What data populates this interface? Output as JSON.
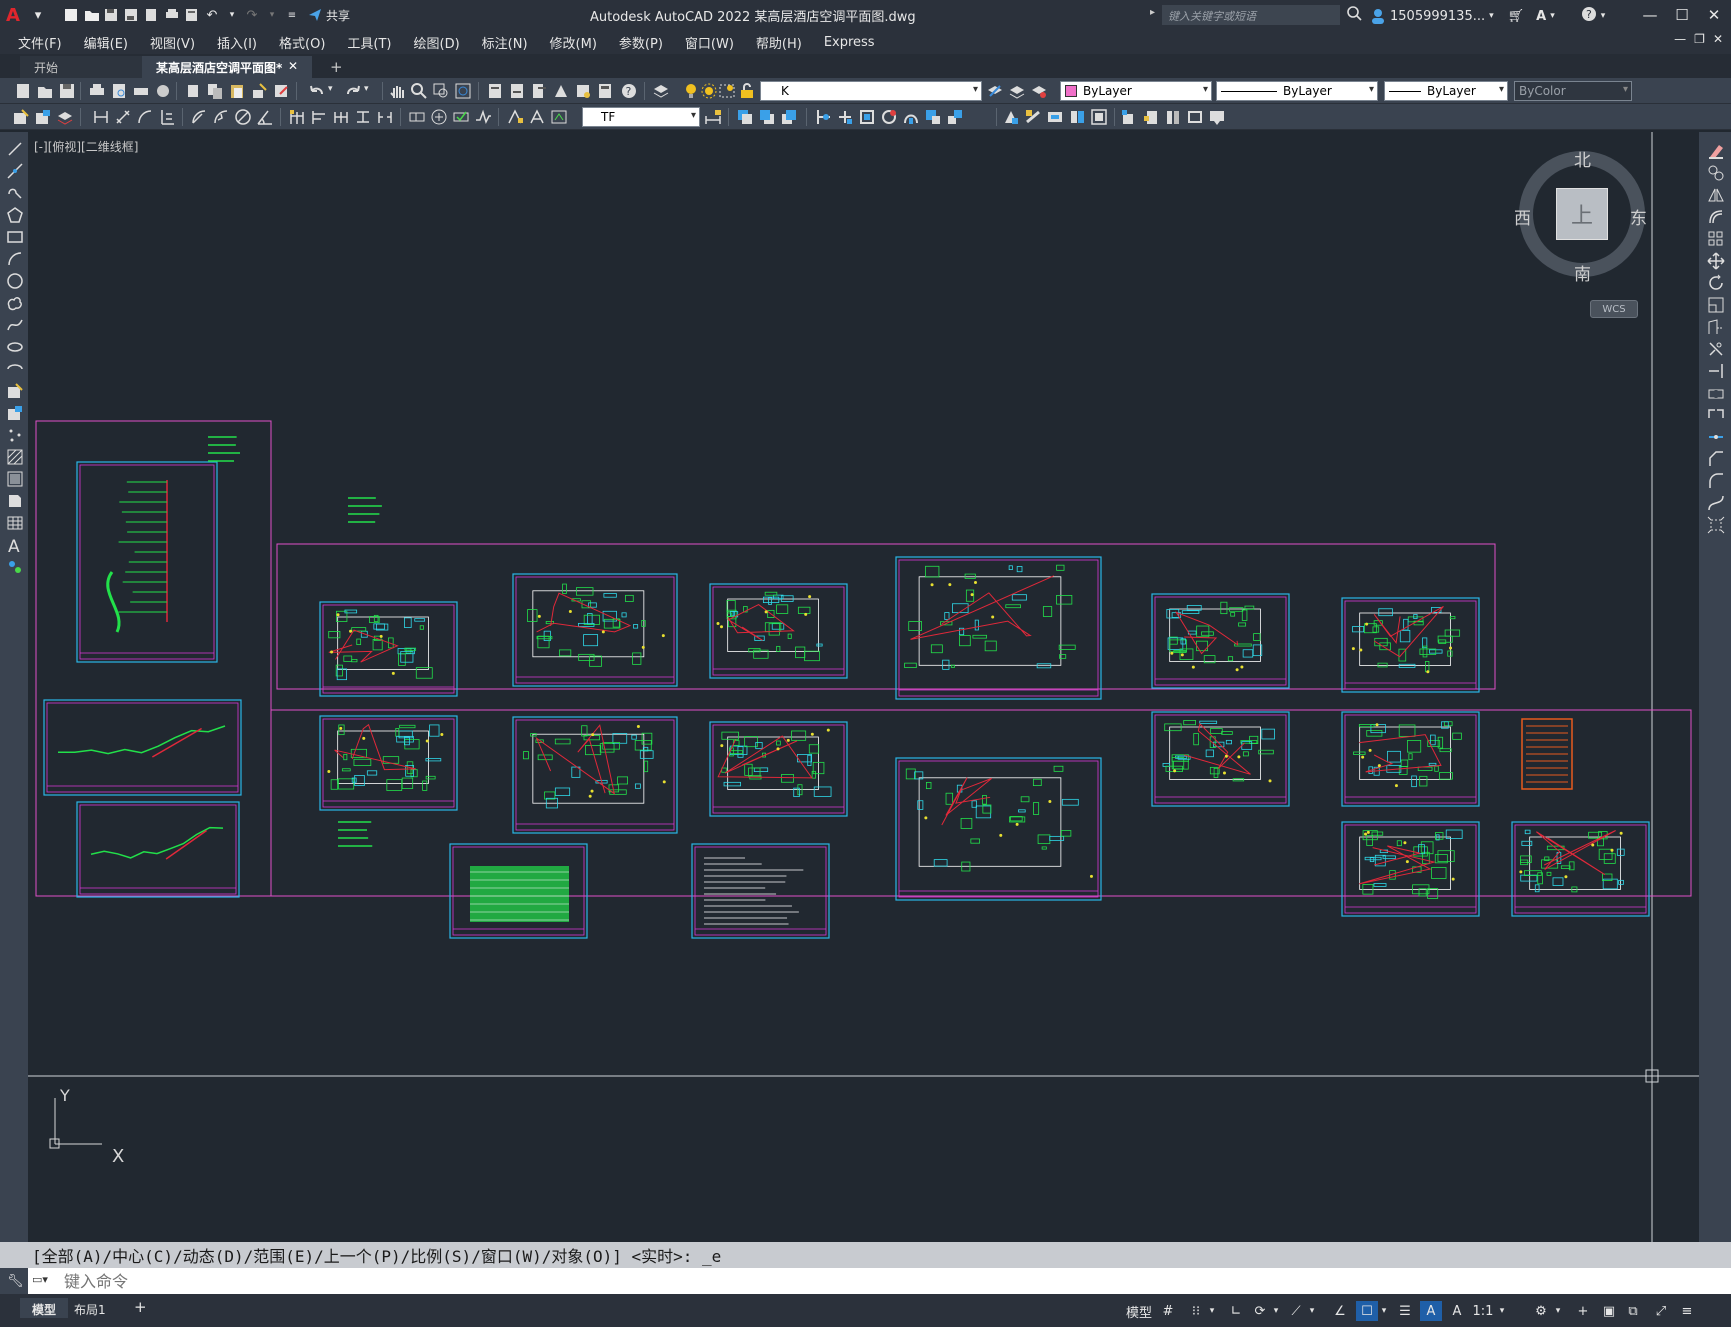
{
  "app": {
    "title": "Autodesk AutoCAD 2022    某高层酒店空调平面图.dwg",
    "logo": "A",
    "share_label": "共享",
    "search_placeholder": "键入关键字或短语",
    "user": "1505999135...",
    "accent_color": "#e0262d"
  },
  "menu": {
    "items": [
      "文件(F)",
      "编辑(E)",
      "视图(V)",
      "插入(I)",
      "格式(O)",
      "工具(T)",
      "绘图(D)",
      "标注(N)",
      "修改(M)",
      "参数(P)",
      "窗口(W)",
      "帮助(H)",
      "Express"
    ]
  },
  "tabs": {
    "start": "开始",
    "drawing": "某高层酒店空调平面图*",
    "close": "✕",
    "add": "+"
  },
  "toolbar": {
    "layer_value": "K",
    "color_value": "ByLayer",
    "linetype_value": "ByLayer",
    "lineweight_value": "ByLayer",
    "plotstyle_value": "ByColor",
    "textstyle_value": "TF"
  },
  "viewport": {
    "label": "[-][俯视][二维线框]"
  },
  "viewcube": {
    "north": "北",
    "south": "南",
    "east": "东",
    "west": "西",
    "face": "上",
    "wcs": "WCS"
  },
  "ucs": {
    "x_label": "X",
    "y_label": "Y"
  },
  "command": {
    "history": "[全部(A)/中心(C)/动态(D)/范围(E)/上一个(P)/比例(S)/窗口(W)/对象(O)] <实时>: _e",
    "placeholder": "键入命令"
  },
  "status": {
    "model_tab": "模型",
    "layout_tab": "布局1",
    "add_tab": "+",
    "model_space": "模型",
    "scale": "1:1"
  },
  "colors": {
    "canvas": "#212830",
    "sheet_border_cyan": "#29b6e6",
    "sheet_border_magenta": "#d838d8",
    "group_frame": "#e050c8",
    "plan_green": "#22e04a",
    "plan_red": "#e0283a",
    "plan_yellow": "#e8e030",
    "table_sheet": "#e85a1e"
  }
}
